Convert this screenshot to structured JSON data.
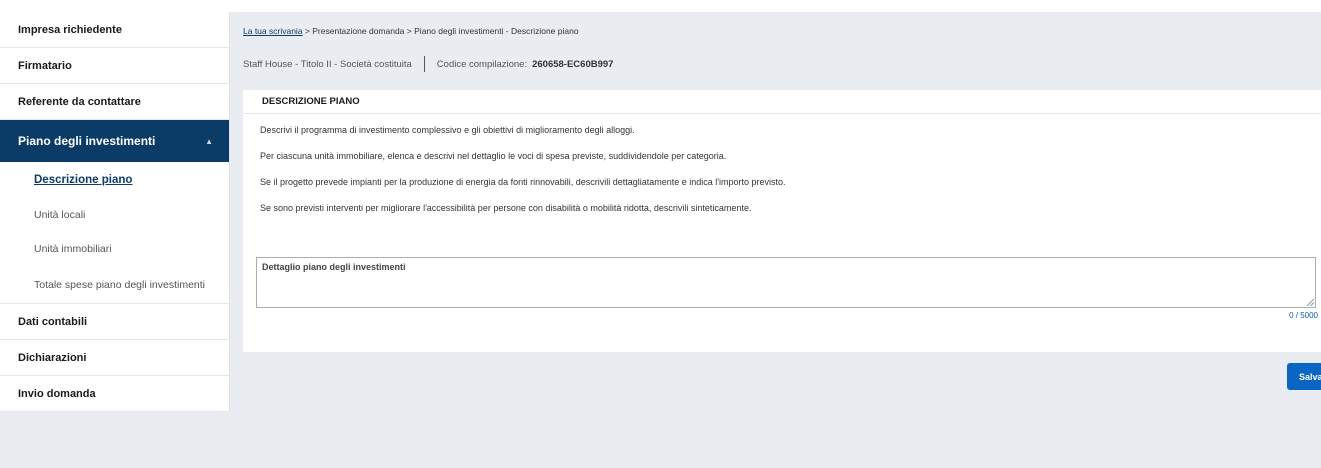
{
  "sidebar": {
    "items_before": [
      {
        "label": "Impresa richiedente"
      },
      {
        "label": "Firmatario"
      },
      {
        "label": "Referente da contattare"
      }
    ],
    "active_section": {
      "label": "Piano degli investimenti",
      "chevron_icon": "chevron-up-icon",
      "subitems": [
        {
          "label": "Descrizione piano",
          "current": true
        },
        {
          "label": "Unità locali"
        },
        {
          "label": "Unità immobiliari"
        },
        {
          "label": "Totale spese piano degli investimenti"
        }
      ]
    },
    "items_after": [
      {
        "label": "Dati contabili"
      },
      {
        "label": "Dichiarazioni"
      },
      {
        "label": "Invio domanda"
      }
    ]
  },
  "breadcrumb": {
    "home_link": "La tua scrivania",
    "separator": ">",
    "step2": "Presentazione domanda",
    "step3": "Piano degli investimenti - Descrizione piano"
  },
  "subheader": {
    "title": "Staff House - Titolo II  -  Società costituita",
    "code_label": "Codice compilazione:",
    "code_value": "260658-EC60B997"
  },
  "card": {
    "title": "DESCRIZIONE PIANO",
    "instructions": [
      "Descrivi il programma di investimento complessivo e gli obiettivi di miglioramento degli alloggi.",
      "Per ciascuna unità immobiliare, elenca e descrivi nel dettaglio le voci di spesa previste, suddividendole per categoria.",
      "Se il progetto prevede impianti per la produzione di energia da fonti rinnovabili, descrivili dettagliatamente e indica l'importo previsto.",
      "Se sono previsti interventi per migliorare l'accessibilità per persone con disabilità o mobilità ridotta, descrivili sinteticamente."
    ],
    "textarea": {
      "label": "Dettaglio piano degli investimenti",
      "value": "",
      "counter": "0 / 5000"
    }
  },
  "actions": {
    "save_label": "Salva"
  },
  "colors": {
    "accent": "#0b3c68",
    "button": "#0a66c2",
    "background": "#e9edf2"
  }
}
